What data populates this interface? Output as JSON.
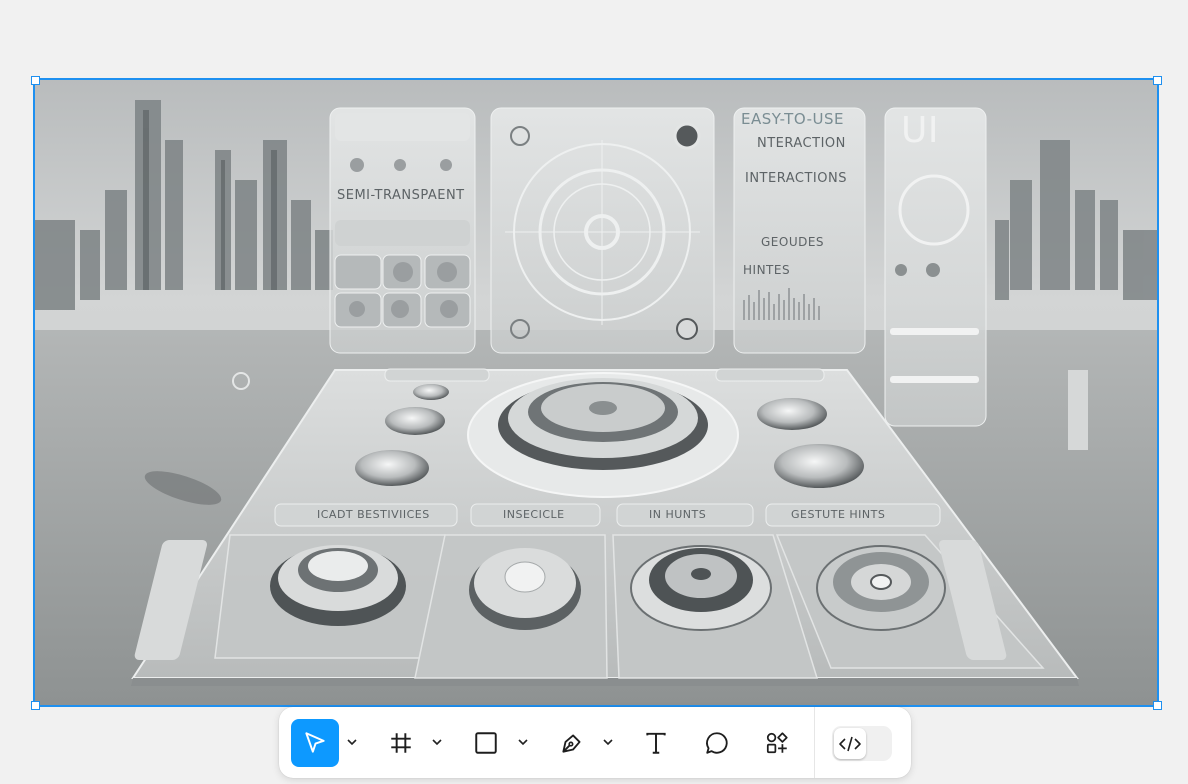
{
  "canvas": {
    "image_texts": {
      "semi_transparent": "SEMI-TRANSPAENT",
      "easy_to_use": "EASY-TO-USE",
      "interaction": "NTERACTION",
      "interactions": "INTERACTIONS",
      "gestures": "GEOUDES",
      "hints": "HINTES",
      "ui": "UI",
      "label_a": "ICADT BESTIVIICES",
      "label_b": "INSECICLE",
      "label_c": "IN HUNTS",
      "label_d": "GESTUTE HINTS"
    },
    "selection_color": "#1e90f0"
  },
  "toolbar": {
    "tools": [
      {
        "name": "move-tool",
        "icon": "cursor-arrow-icon",
        "active": true
      },
      {
        "name": "frame-tool",
        "icon": "frame-hash-icon",
        "active": false
      },
      {
        "name": "shape-tool",
        "icon": "rectangle-icon",
        "active": false
      },
      {
        "name": "pen-tool",
        "icon": "pen-nib-icon",
        "active": false
      },
      {
        "name": "text-tool",
        "icon": "text-t-icon",
        "active": false
      },
      {
        "name": "comment-tool",
        "icon": "speech-bubble-icon",
        "active": false
      },
      {
        "name": "resources-tool",
        "icon": "shapes-plus-icon",
        "active": false
      }
    ],
    "dev_mode_toggle": {
      "icon": "code-brackets-icon",
      "on": false
    },
    "accent": "#0d99ff"
  }
}
